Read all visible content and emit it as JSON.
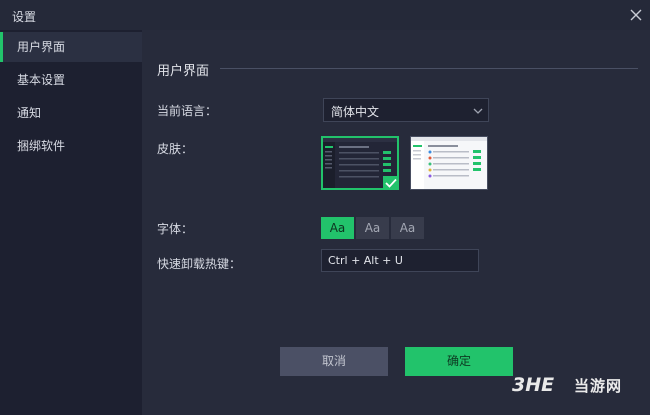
{
  "window": {
    "title": "设置",
    "close_icon": "close-icon"
  },
  "sidebar": {
    "items": [
      {
        "label": "用户界面",
        "active": true
      },
      {
        "label": "基本设置",
        "active": false
      },
      {
        "label": "通知",
        "active": false
      },
      {
        "label": "捆绑软件",
        "active": false
      }
    ]
  },
  "main": {
    "section_title": "用户界面",
    "language": {
      "label": "当前语言：",
      "value": "简体中文"
    },
    "skin": {
      "label": "皮肤：",
      "selected": "dark"
    },
    "font": {
      "label": "字体：",
      "options": [
        "Aa",
        "Aa",
        "Aa"
      ],
      "selected_index": 0
    },
    "hotkey": {
      "label": "快速卸载热键：",
      "value": "Ctrl + Alt + U"
    }
  },
  "footer": {
    "cancel_label": "取消",
    "ok_label": "确定"
  },
  "watermark": {
    "text": "当游网"
  },
  "colors": {
    "accent": "#22c36b",
    "background": "#272b3b",
    "sidebar": "#1d2030"
  }
}
